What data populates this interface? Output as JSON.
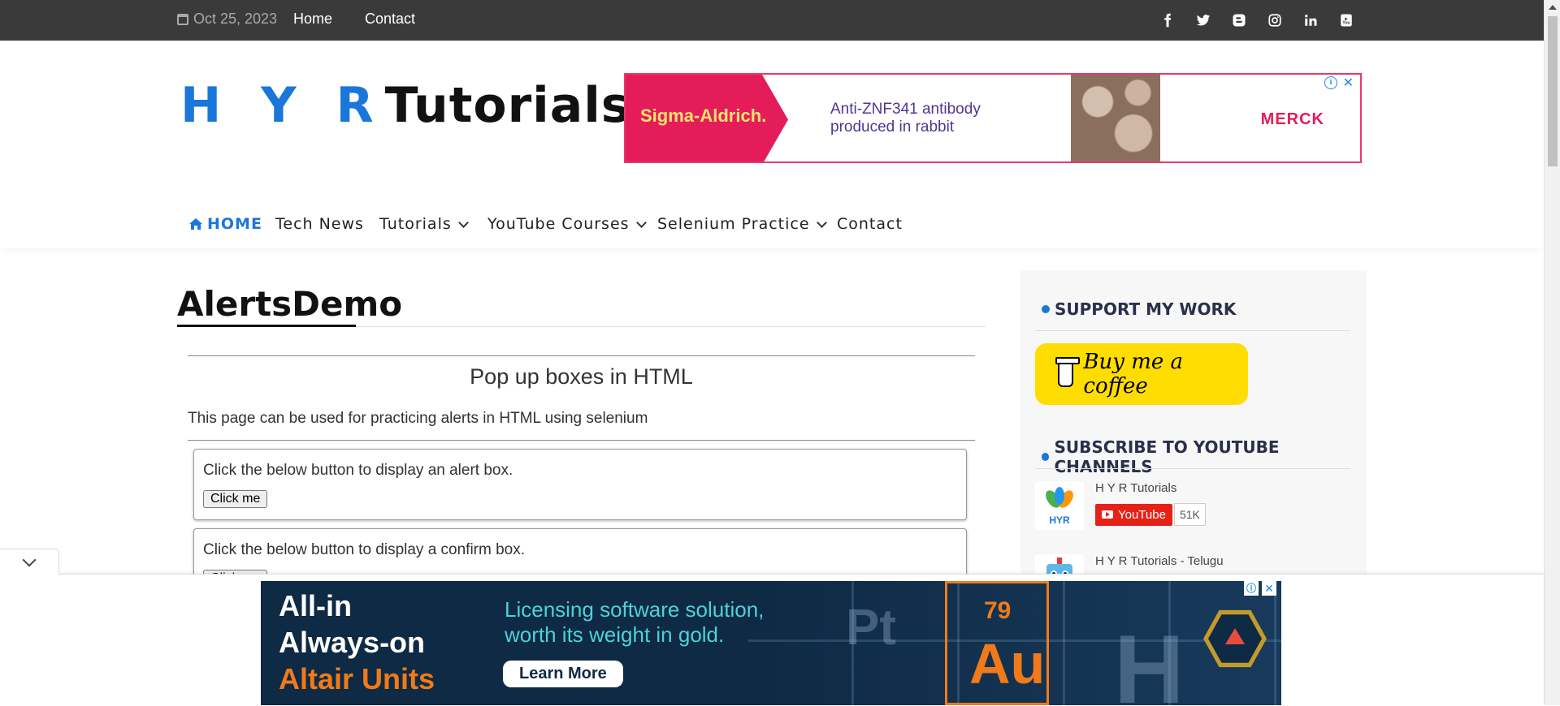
{
  "topbar": {
    "date": "Oct 25, 2023",
    "links": [
      "Home",
      "Contact"
    ],
    "social_icons": [
      "facebook-icon",
      "twitter-icon",
      "blogger-icon",
      "instagram-icon",
      "linkedin-icon",
      "youtube-icon"
    ]
  },
  "header": {
    "logo_initials": "H Y R",
    "logo_word": "Tutorials"
  },
  "ad_top": {
    "brand": "Sigma-Aldrich.",
    "line1": "Anti-ZNF341 antibody",
    "line2": "produced in rabbit",
    "partner": "MERCK"
  },
  "nav": {
    "items": [
      "HOME",
      "Tech News",
      "Tutorials",
      "YouTube Courses",
      "Selenium Practice",
      "Contact"
    ]
  },
  "main": {
    "title": "AlertsDemo",
    "subheading": "Pop up boxes in HTML",
    "intro": "This page can be used for practicing alerts in HTML using selenium",
    "boxes": [
      {
        "message": "Click the below button to display an alert box.",
        "button": "Click me"
      },
      {
        "message": "Click the below button to display a confirm box.",
        "button": "Click me"
      }
    ]
  },
  "sidebar": {
    "support_title": "SUPPORT MY WORK",
    "coffee_label": "Buy me a coffee",
    "subscribe_title": "SUBSCRIBE TO YOUTUBE CHANNELS",
    "channels": [
      {
        "name": "H Y R Tutorials",
        "button": "YouTube",
        "count": "51K"
      },
      {
        "name": "H Y R Tutorials - Telugu"
      }
    ]
  },
  "ad_bottom": {
    "line1": "All-in",
    "line2": "Always-on",
    "line3": "Altair Units",
    "tagline1": "Licensing software solution,",
    "tagline2": "worth its weight in gold.",
    "cta": "Learn More",
    "element_number": "79",
    "element_symbol": "Au",
    "bg_symbols": [
      "Pt",
      "H"
    ],
    "colors": {
      "orange": "#f07a1a",
      "teal": "#4fd1d9",
      "navy": "#0e2a44"
    }
  },
  "colors": {
    "accent": "#1a77d9",
    "topbar": "#3a3a3a",
    "coffee": "#ffdd00",
    "youtube": "#e62117"
  }
}
